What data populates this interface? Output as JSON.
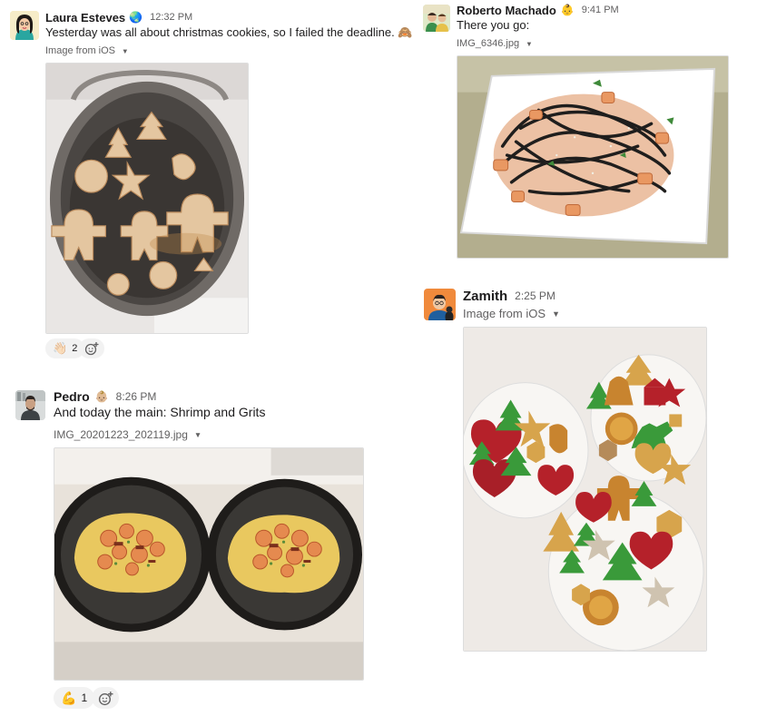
{
  "messages": [
    {
      "author": "Laura Esteves",
      "status_emoji": "🌏",
      "time": "12:32 PM",
      "text": "Yesterday was all about christmas cookies, so I failed the deadline. 🙈",
      "file_label": "Image from iOS",
      "reactions": [
        {
          "emoji": "👋🏻",
          "count": "2"
        }
      ]
    },
    {
      "author": "Pedro",
      "status_emoji": "👶🏼",
      "time": "8:26 PM",
      "text": "And today the main: Shrimp and Grits",
      "file_label": "IMG_20201223_202119.jpg",
      "reactions": [
        {
          "emoji": "💪",
          "count": "1"
        }
      ]
    },
    {
      "author": "Roberto Machado",
      "status_emoji": "👶",
      "time": "9:41 PM",
      "text": "There you go:",
      "file_label": "IMG_6346.jpg"
    },
    {
      "author": "Zamith",
      "time": "2:25 PM",
      "file_label": "Image from iOS"
    }
  ],
  "colors": {
    "text": "#1d1c1d",
    "muted": "#616061",
    "reaction_bg": "#f2f2f2"
  }
}
